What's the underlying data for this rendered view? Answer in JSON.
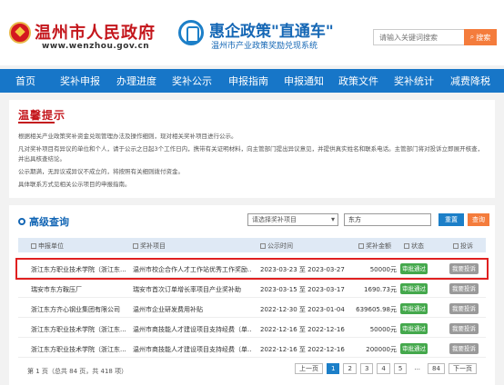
{
  "header": {
    "site_name": "温州市人民政府",
    "site_url": "www.wenzhou.gov.cn",
    "slogan": "惠企政策\"直通车\"",
    "slogan_sub": "温州市产业政策奖励兑现系统",
    "search_placeholder": "请输入关键词搜索",
    "search_label": "搜索"
  },
  "nav": [
    "首页",
    "奖补申报",
    "办理进度",
    "奖补公示",
    "申报指南",
    "申报通知",
    "政策文件",
    "奖补统计",
    "减费降税"
  ],
  "notice": {
    "title": "温馨提示",
    "lines": [
      "根据相关产业政策奖补资金兑现管理办法及操作细则，现对相关奖补项目进行公示。",
      "凡对奖补项目有异议的单位和个人，请于公示之日起3个工作日内，携带有关证明材料，向主管部门提出异议意见，并提供真实姓名和联系电话。主管部门将对投诉立即展开核查，并出具核查结论。",
      "公示期满，无异议或异议不成立的，将按照有关细则拨付资金。",
      "具体联系方式见相关公示项目的申报指南。"
    ]
  },
  "query": {
    "title": "高级查询",
    "select_placeholder": "请选择奖补项目",
    "keyword": "东方",
    "reset_label": "重置",
    "search_label": "查询",
    "columns": [
      "申报单位",
      "奖补项目",
      "公示时间",
      "奖补金额",
      "状态",
      "投诉"
    ],
    "rows": [
      {
        "unit": "浙江东方职业技术学院（浙江东...",
        "project": "温州市校企合作人才工作站优秀工作奖励...",
        "period": "2023-03-23 至 2023-03-27",
        "amount": "50000元",
        "status": "审批通过",
        "action": "我要投诉"
      },
      {
        "unit": "瑞安市东方鞍压厂",
        "project": "瑞安市首次订单增长率项目产业奖补助",
        "period": "2023-03-15 至 2023-03-17",
        "amount": "1690.73元",
        "status": "审批通过",
        "action": "我要投诉"
      },
      {
        "unit": "浙江东方齐心钢业集团有限公司",
        "project": "温州市企业研发费用补贴",
        "period": "2022-12-30 至 2023-01-04",
        "amount": "639605.98元",
        "status": "审批通过",
        "action": "我要投诉"
      },
      {
        "unit": "浙江东方职业技术学院（浙江东...",
        "project": "温州市商技能人才建设项目支持经费（单...",
        "period": "2022-12-16 至 2022-12-16",
        "amount": "50000元",
        "status": "审批通过",
        "action": "我要投诉"
      },
      {
        "unit": "浙江东方职业技术学院（浙江东...",
        "project": "温州市商技能人才建设项目支持经费（单...",
        "period": "2022-12-16 至 2022-12-16",
        "amount": "200000元",
        "status": "审批通过",
        "action": "我要投诉"
      }
    ],
    "footer": "第 1 页（总共 84 页，共 418 项）",
    "pager": [
      "上一页",
      "1",
      "2",
      "3",
      "4",
      "5",
      "...",
      "84",
      "下一页"
    ]
  }
}
